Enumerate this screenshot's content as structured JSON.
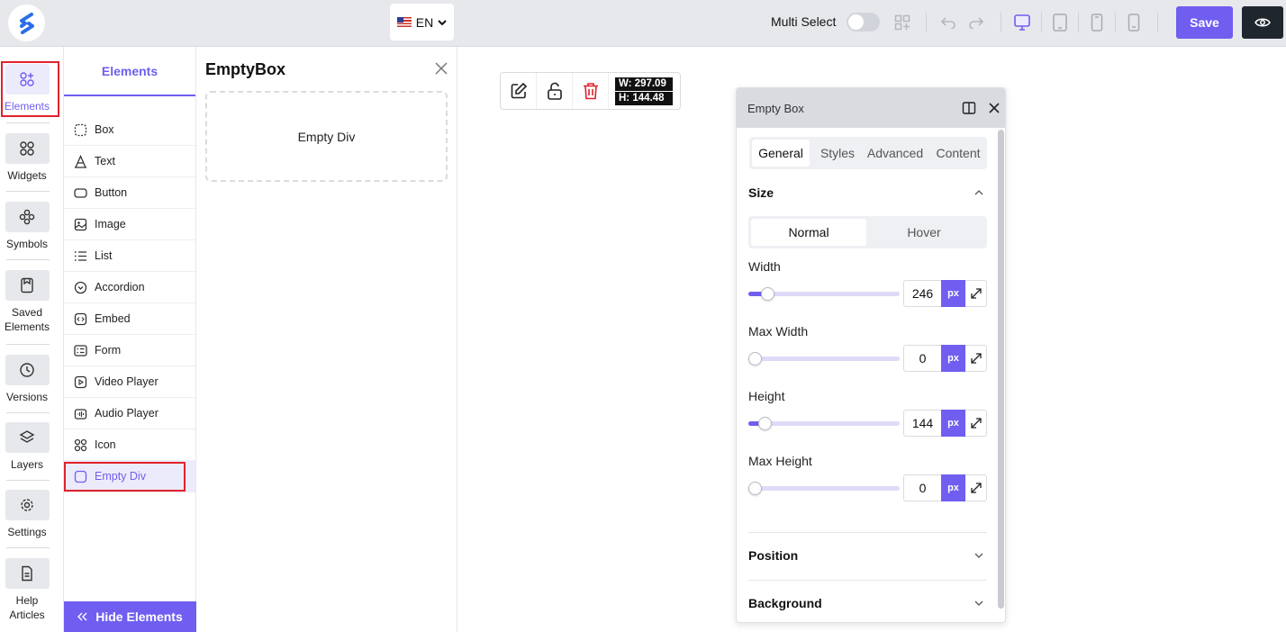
{
  "topbar": {
    "language": "EN",
    "multi_select_label": "Multi Select",
    "multi_select_on": false,
    "save_label": "Save",
    "accent_color": "#6f5ef0"
  },
  "rail": {
    "items": [
      {
        "label": "Elements",
        "icon": "elements-icon",
        "active": true
      },
      {
        "label": "Widgets",
        "icon": "widgets-icon"
      },
      {
        "label": "Symbols",
        "icon": "symbols-icon"
      },
      {
        "label": "Saved\nElements",
        "line1": "Saved",
        "line2": "Elements",
        "icon": "saved-elements-icon"
      },
      {
        "label": "Versions",
        "icon": "versions-icon"
      },
      {
        "label": "Layers",
        "icon": "layers-icon"
      },
      {
        "label": "Settings",
        "icon": "settings-icon"
      },
      {
        "line1": "Help",
        "line2": "Articles",
        "icon": "help-articles-icon"
      }
    ]
  },
  "elements_panel": {
    "tab_label": "Elements",
    "items": [
      {
        "label": "Box",
        "icon": "box-icon"
      },
      {
        "label": "Text",
        "icon": "text-icon"
      },
      {
        "label": "Button",
        "icon": "button-icon"
      },
      {
        "label": "Image",
        "icon": "image-icon"
      },
      {
        "label": "List",
        "icon": "list-icon"
      },
      {
        "label": "Accordion",
        "icon": "accordion-icon"
      },
      {
        "label": "Embed",
        "icon": "embed-icon"
      },
      {
        "label": "Form",
        "icon": "form-icon"
      },
      {
        "label": "Video Player",
        "icon": "video-player-icon"
      },
      {
        "label": "Audio Player",
        "icon": "audio-player-icon"
      },
      {
        "label": "Icon",
        "icon": "icon-icon"
      },
      {
        "label": "Empty Div",
        "icon": "empty-div-icon",
        "active": true
      }
    ],
    "hide_label": "Hide Elements"
  },
  "emptybox_panel": {
    "title": "EmptyBox",
    "card_label": "Empty Div"
  },
  "canvas": {
    "width_readout": "W: 297.09",
    "height_readout": "H: 144.48"
  },
  "props": {
    "title": "Empty Box",
    "tabs": [
      "General",
      "Styles",
      "Advanced",
      "Content"
    ],
    "active_tab": "General",
    "size_title": "Size",
    "states": [
      "Normal",
      "Hover"
    ],
    "active_state": "Normal",
    "fields": [
      {
        "label": "Width",
        "value": "246",
        "unit": "px",
        "slider_fraction": 0.09
      },
      {
        "label": "Max Width",
        "value": "0",
        "unit": "px",
        "slider_fraction": 0.0
      },
      {
        "label": "Height",
        "value": "144",
        "unit": "px",
        "slider_fraction": 0.07
      },
      {
        "label": "Max Height",
        "value": "0",
        "unit": "px",
        "slider_fraction": 0.0
      }
    ],
    "position_title": "Position",
    "background_title": "Background"
  }
}
